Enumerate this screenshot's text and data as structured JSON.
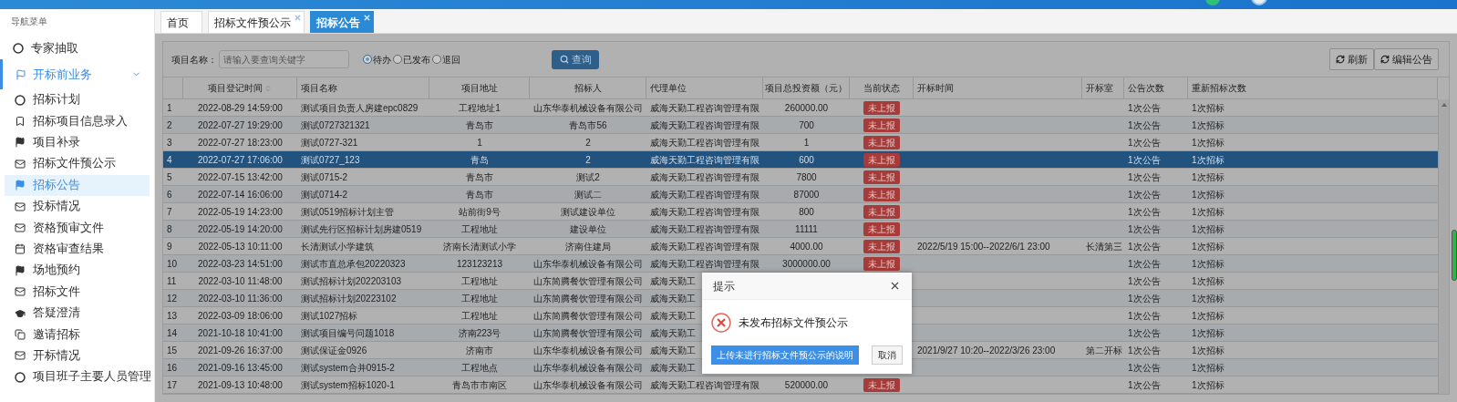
{
  "nav": {
    "title": "导航菜单",
    "items": [
      {
        "label": "专家抽取",
        "kind": "circle",
        "selected": false
      },
      {
        "label": "开标前业务",
        "kind": "flag-outline",
        "expanded": true,
        "children": [
          {
            "label": "招标计划",
            "kind": "circle",
            "selected": false
          },
          {
            "label": "招标项目信息录入",
            "kind": "bookmark",
            "selected": false
          },
          {
            "label": "项目补录",
            "kind": "flag",
            "selected": false
          },
          {
            "label": "招标文件预公示",
            "kind": "mail",
            "selected": false
          },
          {
            "label": "招标公告",
            "kind": "flag",
            "selected": true
          },
          {
            "label": "投标情况",
            "kind": "mail",
            "selected": false
          },
          {
            "label": "资格预审文件",
            "kind": "mail",
            "selected": false
          },
          {
            "label": "资格审查结果",
            "kind": "calendar",
            "selected": false
          },
          {
            "label": "场地预约",
            "kind": "flag",
            "selected": false
          },
          {
            "label": "招标文件",
            "kind": "mail",
            "selected": false
          },
          {
            "label": "答疑澄清",
            "kind": "cap",
            "selected": false
          },
          {
            "label": "邀请招标",
            "kind": "copy",
            "selected": false
          },
          {
            "label": "开标情况",
            "kind": "mail",
            "selected": false
          },
          {
            "label": "项目班子主要人员管理",
            "kind": "circle",
            "selected": false
          }
        ]
      }
    ]
  },
  "tabs": [
    {
      "label": "首页",
      "closable": false,
      "selected": false
    },
    {
      "label": "招标文件预公示",
      "closable": true,
      "selected": false
    },
    {
      "label": "招标公告",
      "closable": true,
      "selected": true
    }
  ],
  "search": {
    "label": "项目名称：",
    "placeholder": "请输入要查询关键字",
    "radios": [
      {
        "label": "待办",
        "selected": true
      },
      {
        "label": "已发布",
        "selected": false
      },
      {
        "label": "退回",
        "selected": false
      }
    ],
    "button": "查询"
  },
  "toolbar": [
    "刷新",
    "编辑公告"
  ],
  "table": {
    "columns": [
      {
        "label": "项目登记时间",
        "sortable": true
      },
      {
        "label": "项目名称"
      },
      {
        "label": "项目地址"
      },
      {
        "label": "招标人"
      },
      {
        "label": "代理单位"
      },
      {
        "label": "项目总投资额（元）"
      },
      {
        "label": "当前状态"
      },
      {
        "label": "开标时间"
      },
      {
        "label": "开标室"
      },
      {
        "label": "公告次数"
      },
      {
        "label": "重新招标次数"
      }
    ],
    "rows": [
      {
        "no": "1",
        "time": "2022-08-29 14:59:00",
        "name": "测试项目负责人房建epc0829",
        "address": "工程地址1",
        "tenderer": "山东华泰机械设备有限公司",
        "agency": "威海天勤工程咨询管理有限",
        "amount": "260000.00",
        "status": "未上报",
        "notices": "1次公告",
        "retenders": "1次招标",
        "selected": false
      },
      {
        "no": "2",
        "time": "2022-07-27 19:29:00",
        "name": "测试0727321321",
        "address": "青岛市",
        "tenderer": "青岛市56",
        "agency": "威海天勤工程咨询管理有限",
        "amount": "700",
        "status": "未上报",
        "notices": "1次公告",
        "retenders": "1次招标",
        "selected": false
      },
      {
        "no": "3",
        "time": "2022-07-27 18:23:00",
        "name": "测试0727-321",
        "address": "1",
        "tenderer": "2",
        "agency": "威海天勤工程咨询管理有限",
        "amount": "1",
        "status": "未上报",
        "notices": "1次公告",
        "retenders": "1次招标",
        "selected": false
      },
      {
        "no": "4",
        "time": "2022-07-27 17:06:00",
        "name": "测试0727_123",
        "address": "青岛",
        "tenderer": "2",
        "agency": "威海天勤工程咨询管理有限",
        "amount": "600",
        "status": "未上报",
        "notices": "1次公告",
        "retenders": "1次招标",
        "selected": true
      },
      {
        "no": "5",
        "time": "2022-07-15 13:42:00",
        "name": "测试0715-2",
        "address": "青岛市",
        "tenderer": "测试2",
        "agency": "威海天勤工程咨询管理有限",
        "amount": "7800",
        "status": "未上报",
        "notices": "1次公告",
        "retenders": "1次招标",
        "selected": false
      },
      {
        "no": "6",
        "time": "2022-07-14 16:06:00",
        "name": "测试0714-2",
        "address": "青岛市",
        "tenderer": "测试二",
        "agency": "威海天勤工程咨询管理有限",
        "amount": "87000",
        "status": "未上报",
        "notices": "1次公告",
        "retenders": "1次招标",
        "selected": false
      },
      {
        "no": "7",
        "time": "2022-05-19 14:23:00",
        "name": "测试0519招标计划主管",
        "address": "站前街9号",
        "tenderer": "测试建设单位",
        "agency": "威海天勤工程咨询管理有限",
        "amount": "800",
        "status": "未上报",
        "notices": "1次公告",
        "retenders": "1次招标",
        "selected": false
      },
      {
        "no": "8",
        "time": "2022-05-19 14:20:00",
        "name": "测试先行区招标计划房建0519",
        "address": "工程地址",
        "tenderer": "建设单位",
        "agency": "威海天勤工程咨询管理有限",
        "amount": "11111",
        "status": "未上报",
        "notices": "1次公告",
        "retenders": "1次招标",
        "selected": false
      },
      {
        "no": "9",
        "time": "2022-05-13 10:11:00",
        "name": "长清测试小学建筑",
        "address": "济南长清测试小学",
        "tenderer": "济南住建局",
        "agency": "威海天勤工程咨询管理有限",
        "amount": "4000.00",
        "status": "未上报",
        "open_time": "2022/5/19 15:00--2022/6/1 23:00",
        "room": "长清第三",
        "notices": "1次公告",
        "retenders": "1次招标",
        "selected": false
      },
      {
        "no": "10",
        "time": "2022-03-23 14:51:00",
        "name": "测试市直总承包20220323",
        "address": "123123213",
        "tenderer": "山东华泰机械设备有限公司",
        "agency": "威海天勤工程咨询管理有限",
        "amount": "3000000.00",
        "status": "未上报",
        "notices": "1次公告",
        "retenders": "1次招标",
        "selected": false
      },
      {
        "no": "11",
        "time": "2022-03-10 11:48:00",
        "name": "测试招标计划202203103",
        "address": "工程地址",
        "tenderer": "山东简腾餐饮管理有限公司",
        "agency": "威海天勤工",
        "notices": "1次公告",
        "retenders": "1次招标",
        "selected": false
      },
      {
        "no": "12",
        "time": "2022-03-10 11:36:00",
        "name": "测试招标计划20223102",
        "address": "工程地址",
        "tenderer": "山东简腾餐饮管理有限公司",
        "agency": "威海天勤工",
        "notices": "1次公告",
        "retenders": "1次招标",
        "selected": false
      },
      {
        "no": "13",
        "time": "2022-03-09 18:06:00",
        "name": "测试1027招标",
        "address": "工程地址",
        "tenderer": "山东简腾餐饮管理有限公司",
        "agency": "威海天勤工",
        "notices": "1次公告",
        "retenders": "1次招标",
        "selected": false
      },
      {
        "no": "14",
        "time": "2021-10-18 10:41:00",
        "name": "测试项目编号问题1018",
        "address": "济南223号",
        "tenderer": "山东简腾餐饮管理有限公司",
        "agency": "威海天勤工",
        "notices": "1次公告",
        "retenders": "1次招标",
        "selected": false
      },
      {
        "no": "15",
        "time": "2021-09-26 16:37:00",
        "name": "测试保证金0926",
        "address": "济南市",
        "tenderer": "山东华泰机械设备有限公司",
        "agency": "威海天勤工",
        "open_time": "2021/9/27 10:20--2022/3/26 23:00",
        "room": "第二开标",
        "notices": "1次公告",
        "retenders": "1次招标",
        "selected": false
      },
      {
        "no": "16",
        "time": "2021-09-16 13:45:00",
        "name": "测试system合并0915-2",
        "address": "工程地点",
        "tenderer": "山东华泰机械设备有限公司",
        "agency": "威海天勤工",
        "notices": "1次公告",
        "retenders": "1次招标",
        "selected": false
      },
      {
        "no": "17",
        "time": "2021-09-13 10:48:00",
        "name": "测试system招标1020-1",
        "address": "青岛市市南区",
        "tenderer": "山东华泰机械设备有限公司",
        "agency": "威海天勤工程咨询管理有限",
        "amount": "520000.00",
        "status": "未上报",
        "notices": "1次公告",
        "retenders": "1次招标",
        "selected": false
      }
    ]
  },
  "dialog": {
    "title": "提示",
    "message": "未发布招标文件预公示",
    "buttons": [
      {
        "label": "上传未进行招标文件预公示的说明",
        "kind": "primary"
      },
      {
        "label": "取消",
        "kind": "default"
      }
    ]
  }
}
